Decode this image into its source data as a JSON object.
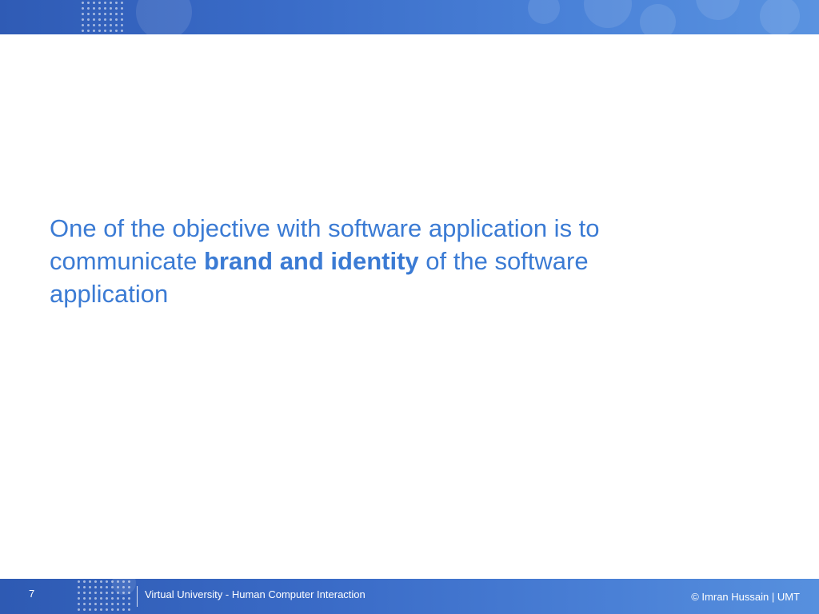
{
  "slide": {
    "body_text": {
      "before_bold": "One of the objective with software application is to communicate ",
      "bold": "brand and identity",
      "after_bold": " of the software application"
    }
  },
  "footer": {
    "page_number": "7",
    "course": "Virtual University - Human Computer Interaction",
    "copyright": "© Imran Hussain | UMT"
  },
  "colors": {
    "text": "#3b7bd4",
    "banner": "#3a6cc8"
  }
}
